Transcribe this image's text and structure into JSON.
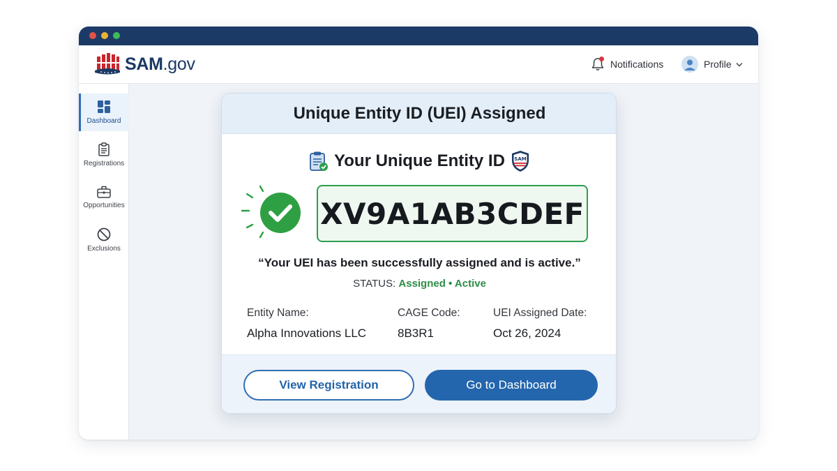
{
  "app": {
    "logo_bold": "SAM",
    "logo_light": ".gov"
  },
  "header": {
    "notifications_label": "Notifications",
    "profile_label": "Profile"
  },
  "sidebar": {
    "items": [
      {
        "label": "Dashboard",
        "icon": "dashboard-icon",
        "active": true
      },
      {
        "label": "Registrations",
        "icon": "clipboard-icon",
        "active": false
      },
      {
        "label": "Opportunities",
        "icon": "briefcase-icon",
        "active": false
      },
      {
        "label": "Exclusions",
        "icon": "prohibited-icon",
        "active": false
      }
    ]
  },
  "card": {
    "title": "Unique Entity ID (UEI) Assigned",
    "subtitle": "Your Unique Entity ID",
    "seal_text": "SAM",
    "uei": "XV9A1AB3CDEF",
    "message": "“Your UEI has been successfully assigned and is active.”",
    "status_prefix": "STATUS:",
    "status_value": "Assigned • Active",
    "info": [
      {
        "label": "Entity Name:",
        "value": "Alpha Innovations LLC"
      },
      {
        "label": "CAGE Code:",
        "value": "8B3R1"
      },
      {
        "label": "UEI Assigned Date:",
        "value": "Oct 26, 2024"
      }
    ],
    "buttons": {
      "secondary": "View Registration",
      "primary": "Go to Dashboard"
    }
  },
  "colors": {
    "brand_navy": "#1c3a66",
    "accent_blue": "#2466ad",
    "success_green": "#2e9e4f",
    "notification_red": "#d9363e"
  }
}
